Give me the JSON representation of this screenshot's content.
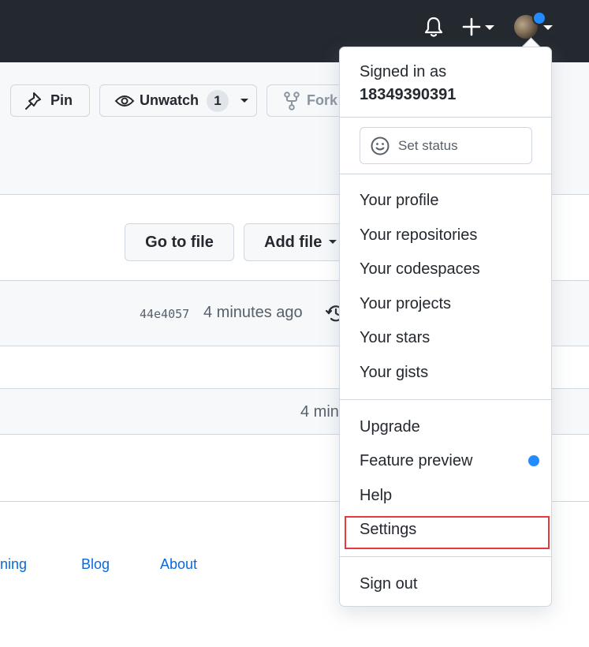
{
  "header": {
    "icons": [
      "bell-icon",
      "plus-icon",
      "caret-down-icon",
      "avatar"
    ],
    "notification_dot_color": "#218bff"
  },
  "repo_actions": {
    "pin_label": "Pin",
    "unwatch_label": "Unwatch",
    "watch_count": "1",
    "fork_label": "Fork"
  },
  "file_nav": {
    "go_to_file_label": "Go to file",
    "add_file_label": "Add file"
  },
  "latest_commit": {
    "sha": "44e4057",
    "time": "4 minutes ago"
  },
  "file_rows": [
    {
      "time": "4 min"
    }
  ],
  "footer": {
    "links": [
      "ining",
      "Blog",
      "About"
    ]
  },
  "user_menu": {
    "signed_in_label": "Signed in as",
    "username": "18349390391",
    "set_status_label": "Set status",
    "items": [
      "Your profile",
      "Your repositories",
      "Your codespaces",
      "Your projects",
      "Your stars",
      "Your gists",
      "Upgrade",
      "Feature preview",
      "Help",
      "Settings",
      "Sign out"
    ],
    "highlighted_item": "Settings",
    "highlight_color": "#e5393f",
    "accent_color": "#218bff"
  }
}
